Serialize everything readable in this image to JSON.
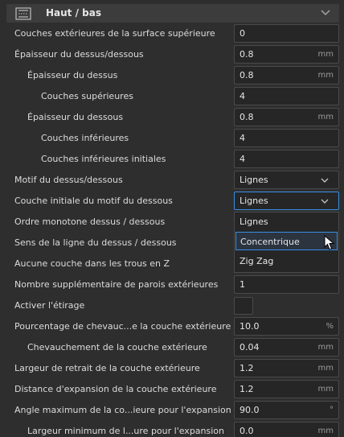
{
  "section": {
    "title": "Haut / bas",
    "icon": "category-icon",
    "collapse_icon": "chevron-down-icon"
  },
  "settings": [
    {
      "label": "Couches extérieures de la surface supérieure",
      "value": "0",
      "unit": ""
    },
    {
      "label": "Épaisseur du dessus/dessous",
      "value": "0.8",
      "unit": "mm"
    },
    {
      "label": "Épaisseur du dessus",
      "value": "0.8",
      "unit": "mm"
    },
    {
      "label": "Couches supérieures",
      "value": "4",
      "unit": ""
    },
    {
      "label": "Épaisseur du dessous",
      "value": "0.8",
      "unit": "mm"
    },
    {
      "label": "Couches inférieures",
      "value": "4",
      "unit": ""
    },
    {
      "label": "Couches inférieures initiales",
      "value": "4",
      "unit": ""
    },
    {
      "label": "Motif du dessus/dessous",
      "value": "Lignes",
      "unit": ""
    },
    {
      "label": "Couche initiale du motif du dessous",
      "value": "Lignes",
      "unit": ""
    },
    {
      "label": "Ordre monotone dessus / dessous",
      "value": "",
      "unit": ""
    },
    {
      "label": "Sens de la ligne du dessus / dessous",
      "value": "",
      "unit": ""
    },
    {
      "label": "Aucune couche dans les trous en Z",
      "value": "",
      "unit": ""
    },
    {
      "label": "Nombre supplémentaire de parois extérieures",
      "value": "1",
      "unit": ""
    },
    {
      "label": "Activer l'étirage",
      "value": "",
      "unit": ""
    },
    {
      "label": "Pourcentage de chevauc...e la couche extérieure",
      "value": "10.0",
      "unit": "%"
    },
    {
      "label": "Chevauchement de la couche extérieure",
      "value": "0.04",
      "unit": "mm"
    },
    {
      "label": "Largeur de retrait de la couche extérieure",
      "value": "1.2",
      "unit": "mm"
    },
    {
      "label": "Distance d'expansion de la couche extérieure",
      "value": "1.2",
      "unit": "mm"
    },
    {
      "label": "Angle maximum de la co...ieure pour l'expansion",
      "value": "90.0",
      "unit": "°"
    },
    {
      "label": "Largeur minimum de l...ure pour l'expansion",
      "value": "0.0",
      "unit": "mm"
    }
  ],
  "dropdown_popup": {
    "options": [
      "Lignes",
      "Concentrique",
      "Zig Zag"
    ],
    "hovered": "Concentrique"
  },
  "colors": {
    "background": "#2e2e2e",
    "field": "#262626",
    "accent": "#3a8ee6",
    "text": "#dcdcdc"
  }
}
